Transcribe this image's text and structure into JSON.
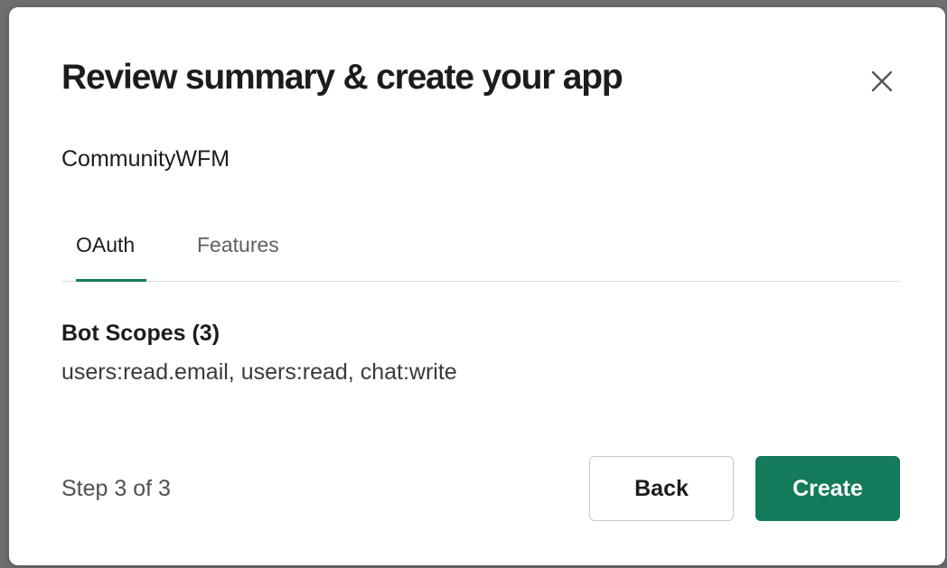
{
  "modal": {
    "title": "Review summary & create your app",
    "close_icon": "close-icon",
    "app_name": "CommunityWFM"
  },
  "tabs": [
    {
      "label": "OAuth",
      "active": true
    },
    {
      "label": "Features",
      "active": false
    }
  ],
  "oauth": {
    "section_title": "Bot Scopes (3)",
    "scopes_text": "users:read.email, users:read, chat:write"
  },
  "footer": {
    "step_text": "Step 3 of 3",
    "back_label": "Back",
    "create_label": "Create"
  },
  "colors": {
    "accent": "#147a5c",
    "text": "#1d1c1d",
    "muted": "#616061"
  }
}
